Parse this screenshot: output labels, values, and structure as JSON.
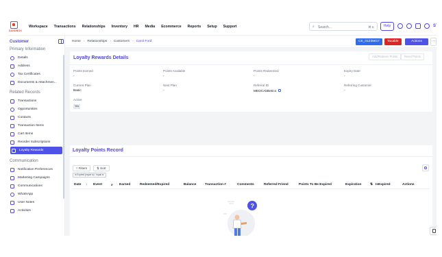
{
  "topbar": {
    "logo_text": "SANDBOX",
    "nav": [
      "Workspace",
      "Transactions",
      "Relationships",
      "Inventory",
      "HR",
      "Media",
      "Ecommerce",
      "Reports",
      "Setup",
      "Support"
    ],
    "search_placeholder": "Search...",
    "search_shortcut": "⌘ K",
    "help_label": "Help",
    "user_initials": "ST"
  },
  "sidebar": {
    "title": "Customer",
    "sections": [
      {
        "title": "Primary Information",
        "items": [
          "Details",
          "Address",
          "Tax Certificates",
          "Documents & Attachmen..."
        ]
      },
      {
        "title": "Related Records",
        "items": [
          "Transactions",
          "Opportunities",
          "Contacts",
          "Transaction Items",
          "Cart Items",
          "Reorder Subscriptions",
          "Loyalty Rewards"
        ]
      },
      {
        "title": "Communication",
        "items": [
          "Notification Preferences",
          "Marketing Campaigns",
          "Communications",
          "WhatsApp",
          "User Notes",
          "Activities"
        ]
      }
    ],
    "active_item": "Loyalty Rewards"
  },
  "breadcrumb": [
    "Home",
    "Relationships",
    "Customers",
    "Carol Ford"
  ],
  "header_tags": {
    "customer_id": "CE_01Z35817",
    "taxable": "Taxable",
    "actions": "Actions",
    "more": "···"
  },
  "loyalty_details": {
    "title": "Loyalty Rewards Details",
    "add_button": "Add/Redeem Points",
    "reset_button": "Reset Points",
    "fields": [
      {
        "label": "Points Earned",
        "value": "-"
      },
      {
        "label": "Points Available",
        "value": "-"
      },
      {
        "label": "Points Redeemed",
        "value": "-"
      },
      {
        "label": "Expiry Date",
        "value": "-"
      },
      {
        "label": "Current Plan",
        "value": "Basic"
      },
      {
        "label": "Next Plan",
        "value": "-"
      },
      {
        "label": "Referral ID",
        "value": "MEDCAbBetico"
      },
      {
        "label": "Referring Customer",
        "value": "-"
      },
      {
        "label": "Active",
        "value": "Yes"
      }
    ]
  },
  "points_record": {
    "title": "Loyalty Points Record",
    "filters_label": "Filters",
    "sort_label": "Sort",
    "filter_chip": "Is Expired (equal to) : equal to",
    "columns": [
      "Date",
      "Event",
      "Earned",
      "Redeemed/Expired",
      "Balance",
      "Transaction #",
      "Comments",
      "Referred Friend",
      "Points To Be Expired",
      "Expiration",
      "IsExpired",
      "Actions"
    ]
  },
  "colors": {
    "accent": "#4f52e6",
    "brand_red": "#e6442e",
    "id_tag": "#2f6df0",
    "taxable_tag": "#dc2626"
  }
}
